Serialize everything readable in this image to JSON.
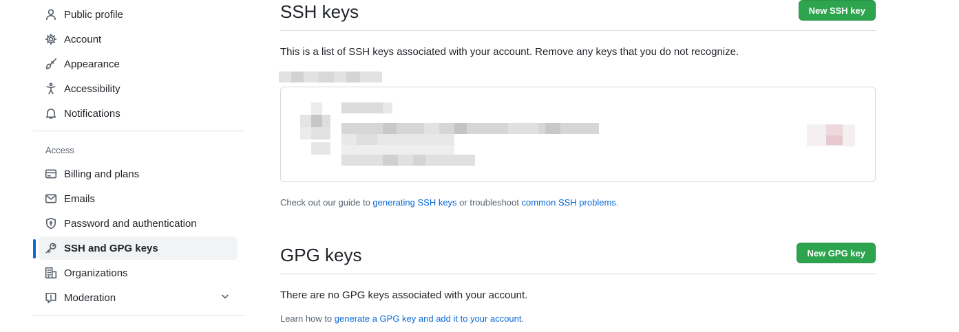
{
  "sidebar": {
    "items": [
      {
        "label": "Public profile",
        "icon": "person-icon"
      },
      {
        "label": "Account",
        "icon": "gear-icon"
      },
      {
        "label": "Appearance",
        "icon": "paintbrush-icon"
      },
      {
        "label": "Accessibility",
        "icon": "accessibility-icon"
      },
      {
        "label": "Notifications",
        "icon": "bell-icon"
      }
    ],
    "access_heading": "Access",
    "access_items": [
      {
        "label": "Billing and plans",
        "icon": "credit-card-icon"
      },
      {
        "label": "Emails",
        "icon": "mail-icon"
      },
      {
        "label": "Password and authentication",
        "icon": "shield-lock-icon"
      },
      {
        "label": "SSH and GPG keys",
        "icon": "key-icon",
        "active": true
      },
      {
        "label": "Organizations",
        "icon": "organization-icon"
      },
      {
        "label": "Moderation",
        "icon": "report-icon"
      }
    ]
  },
  "ssh": {
    "title": "SSH keys",
    "new_button": "New SSH key",
    "description": "This is a list of SSH keys associated with your account. Remove any keys that you do not recognize.",
    "guide_prefix": "Check out our guide to ",
    "guide_link1": "generating SSH keys",
    "guide_middle": " or troubleshoot ",
    "guide_link2": "common SSH problems",
    "guide_suffix": "."
  },
  "gpg": {
    "title": "GPG keys",
    "new_button": "New GPG key",
    "empty_text": "There are no GPG keys associated with your account.",
    "learn_prefix": "Learn how to ",
    "learn_link": "generate a GPG key and add it to your account",
    "learn_suffix": "."
  },
  "colors": {
    "accent": "#0969da",
    "primary_button": "#2da44e"
  }
}
